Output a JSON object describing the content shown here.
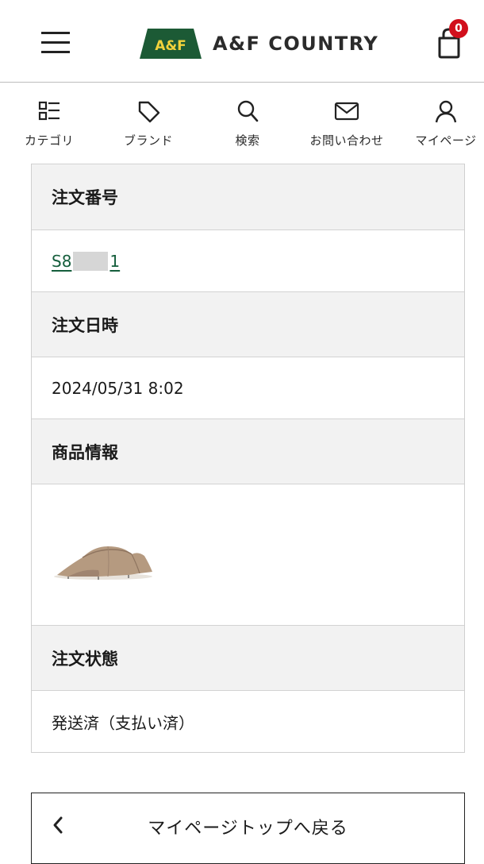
{
  "header": {
    "logo_badge": "A&F",
    "logo_text": "A&F COUNTRY",
    "cart_count": "0",
    "brand_green": "#1c5a35",
    "badge_red": "#d10f1c"
  },
  "subnav": {
    "items": [
      {
        "label": "カテゴリ",
        "icon": "category-icon"
      },
      {
        "label": "ブランド",
        "icon": "tag-icon"
      },
      {
        "label": "検索",
        "icon": "search-icon"
      },
      {
        "label": "お問い合わせ",
        "icon": "mail-icon"
      },
      {
        "label": "マイページ",
        "icon": "user-icon"
      }
    ]
  },
  "order": {
    "number_label": "注文番号",
    "number_prefix": "S8",
    "number_suffix": "1",
    "datetime_label": "注文日時",
    "datetime_value": "2024/05/31 8:02",
    "product_label": "商品情報",
    "product_image": "tent-image",
    "status_label": "注文状態",
    "status_value": "発送済（支払い済）"
  },
  "back_button": {
    "label": "マイページトップへ戻る"
  }
}
